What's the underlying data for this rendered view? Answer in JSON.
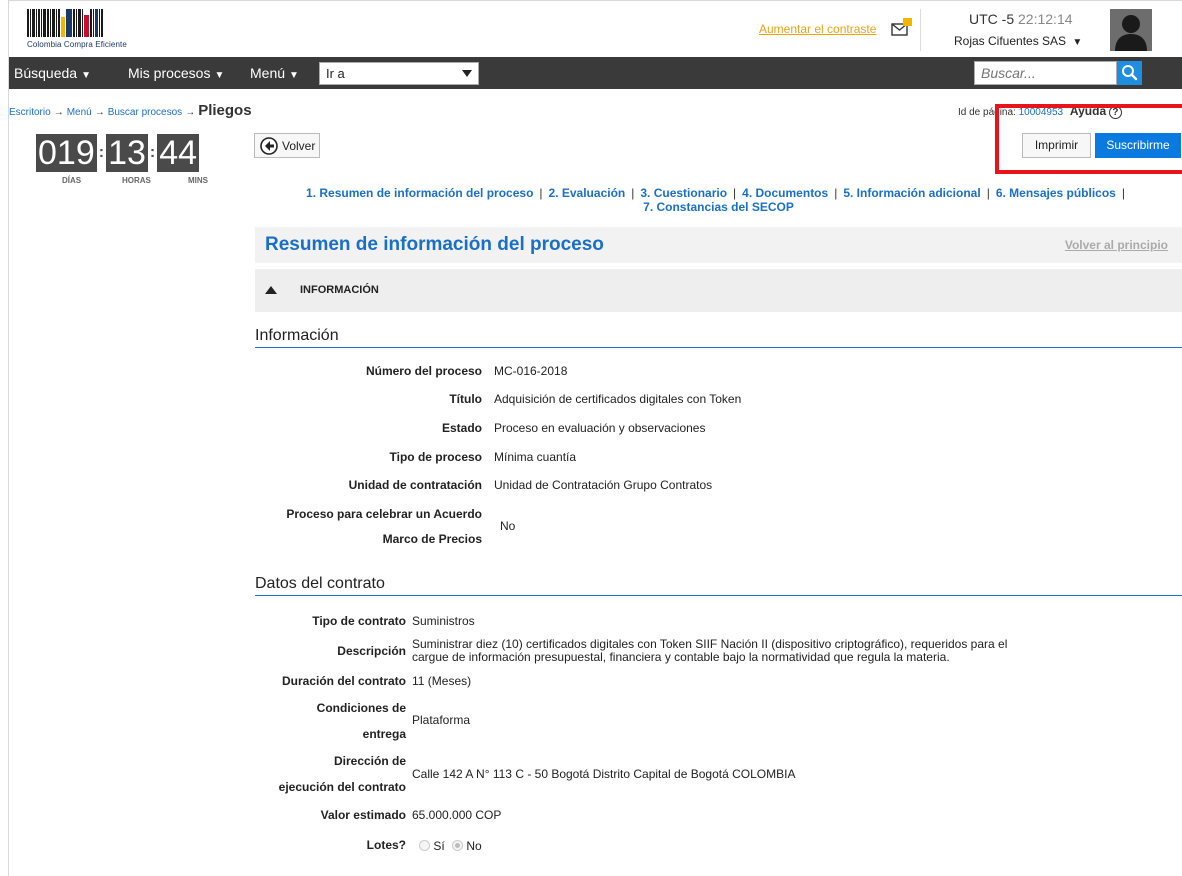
{
  "header": {
    "logo_text": "Colombia Compra Eficiente",
    "contrast_link": "Aumentar el contraste",
    "timezone": "UTC -5",
    "clock": "22:12:14",
    "company": "Rojas Cifuentes SAS"
  },
  "nav": {
    "search_menu": "Búsqueda",
    "my_processes_menu": "Mis procesos",
    "menu": "Menú",
    "goto_value": "Ir a",
    "search_placeholder": "Buscar..."
  },
  "breadcrumb": {
    "items": [
      "Escritorio",
      "Menú",
      "Buscar procesos"
    ],
    "current": "Pliegos"
  },
  "page_id": {
    "label": "Id de página:",
    "value": "10004953",
    "help": "Ayuda"
  },
  "countdown": {
    "days": "019",
    "hours": "13",
    "mins": "44",
    "days_label": "DÍAS",
    "hours_label": "HORAS",
    "mins_label": "MINS"
  },
  "buttons": {
    "back": "Volver",
    "print": "Imprimir",
    "subscribe": "Suscribirme"
  },
  "sections": [
    "1. Resumen de información del proceso",
    "2. Evaluación",
    "3. Cuestionario",
    "4. Documentos",
    "5. Información adicional",
    "6. Mensajes públicos",
    "7. Constancias del SECOP"
  ],
  "summary": {
    "title": "Resumen de información del proceso",
    "back_to_top": "Volver al principio",
    "collapsible_label": "INFORMACIÓN"
  },
  "info": {
    "heading": "Información",
    "rows": [
      {
        "label": "Número del proceso",
        "value": "MC-016-2018"
      },
      {
        "label": "Título",
        "value": "Adquisición de certificados digitales con Token"
      },
      {
        "label": "Estado",
        "value": "Proceso en evaluación y observaciones"
      },
      {
        "label": "Tipo de proceso",
        "value": "Mínima cuantía"
      },
      {
        "label": "Unidad de contratación",
        "value": "Unidad de Contratación Grupo Contratos"
      },
      {
        "label_line1": "Proceso para celebrar un Acuerdo",
        "label_line2": "Marco de Precios",
        "value": "No"
      }
    ]
  },
  "contract": {
    "heading": "Datos del contrato",
    "tipo_label": "Tipo de contrato",
    "tipo_value": "Suministros",
    "desc_label": "Descripción",
    "desc_line1": "Suministrar diez (10) certificados digitales con Token SIIF Nación II (dispositivo criptográfico), requeridos para el",
    "desc_line2": "cargue de información presupuestal, financiera y contable bajo la normatividad que regula la materia.",
    "duration_label": "Duración del contrato",
    "duration_value": "11 (Meses)",
    "delivery_label1": "Condiciones de",
    "delivery_label2": "entrega",
    "delivery_value": "Plataforma",
    "address_label1": "Dirección de",
    "address_label2": "ejecución del contrato",
    "address_value": "Calle 142 A N° 113 C - 50 Bogotá Distrito Capital de Bogotá COLOMBIA",
    "value_label": "Valor estimado",
    "value_value": "65.000.000 COP",
    "lots_label": "Lotes?",
    "lots_yes": "Sí",
    "lots_no": "No",
    "lots_selected": "No"
  }
}
